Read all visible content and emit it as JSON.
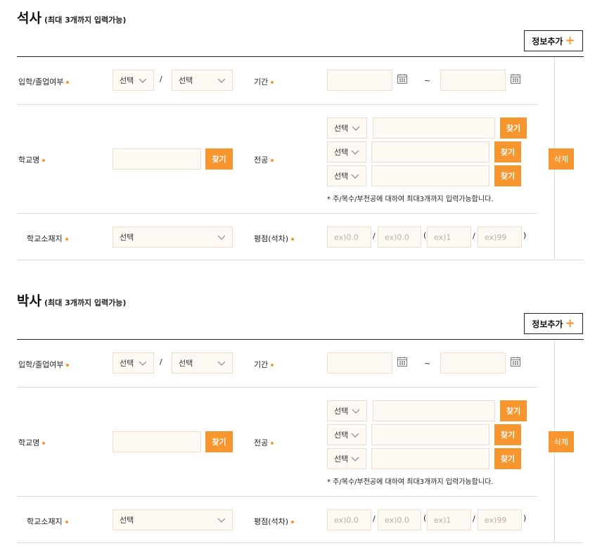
{
  "sections": [
    {
      "title": "석사",
      "subtitle": "(최대 3개까지 입력가능)",
      "add_label": "정보추가",
      "delete_label": "삭제",
      "labels": {
        "enrollment": "입학/졸업여부",
        "period": "기간",
        "school": "학교명",
        "major": "전공",
        "location": "학교소재지",
        "gpa": "평점(석차)"
      },
      "enroll_select_1": "선택",
      "enroll_select_2": "선택",
      "slash": "/",
      "tilde": "~",
      "search_label": "찾기",
      "majors": [
        {
          "select": "선택",
          "search": "찾기"
        },
        {
          "select": "선택",
          "search": "찾기"
        },
        {
          "select": "선택",
          "search": "찾기"
        }
      ],
      "major_note": "* 주/복수/부전공에 대하여 최대3개까지 입력가능합니다.",
      "location_select": "선택",
      "gpa": {
        "p1": "ex)0.0",
        "slash1": "/",
        "p2": "ex)0.0",
        "open": "(",
        "p3": "ex)1",
        "slash2": "/",
        "p4": "ex)99",
        "close": ")"
      }
    },
    {
      "title": "박사",
      "subtitle": "(최대 3개까지 입력가능)",
      "add_label": "정보추가",
      "delete_label": "삭제",
      "labels": {
        "enrollment": "입학/졸업여부",
        "period": "기간",
        "school": "학교명",
        "major": "전공",
        "location": "학교소재지",
        "gpa": "평점(석차)"
      },
      "enroll_select_1": "선택",
      "enroll_select_2": "선택",
      "slash": "/",
      "tilde": "~",
      "search_label": "찾기",
      "majors": [
        {
          "select": "선택",
          "search": "찾기"
        },
        {
          "select": "선택",
          "search": "찾기"
        },
        {
          "select": "선택",
          "search": "찾기"
        }
      ],
      "major_note": "* 주/복수/부전공에 대하여 최대3개까지 입력가능합니다.",
      "location_select": "선택",
      "gpa": {
        "p1": "ex)0.0",
        "slash1": "/",
        "p2": "ex)0.0",
        "open": "(",
        "p3": "ex)1",
        "slash2": "/",
        "p4": "ex)99",
        "close": ")"
      }
    }
  ],
  "colors": {
    "accent": "#f7962e",
    "input_bg": "#fff9f3",
    "input_border": "#e9ddd0",
    "divider": "#dddddd"
  },
  "icons": {
    "calendar": "calendar-icon",
    "chevron": "chevron-down-icon",
    "plus": "plus-icon"
  }
}
